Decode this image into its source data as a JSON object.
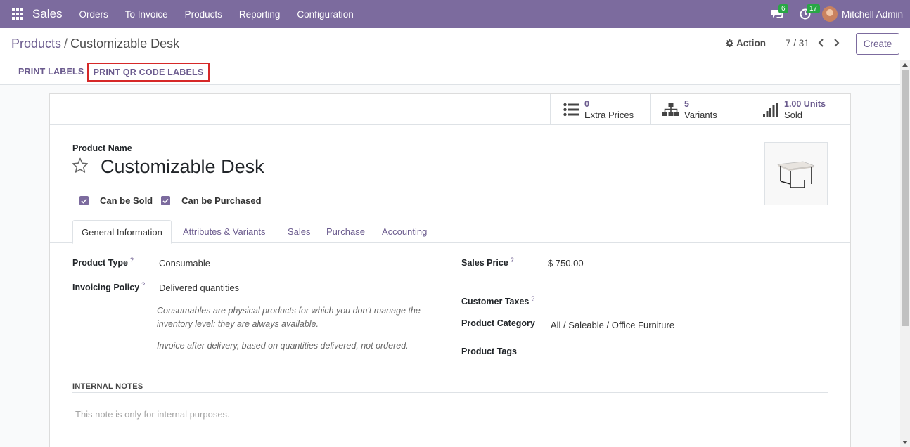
{
  "navbar": {
    "app_name": "Sales",
    "menu": [
      "Orders",
      "To Invoice",
      "Products",
      "Reporting",
      "Configuration"
    ],
    "messages_count": "6",
    "activities_count": "17",
    "user_name": "Mitchell Admin"
  },
  "control_panel": {
    "breadcrumb_parent": "Products",
    "breadcrumb_separator": "/",
    "breadcrumb_current": "Customizable Desk",
    "action_label": "Action",
    "pager": "7 / 31",
    "create_label": "Create"
  },
  "button_bar": {
    "print_labels": "PRINT LABELS",
    "print_qr_labels": "PRINT QR CODE LABELS"
  },
  "smart_buttons": [
    {
      "value": "0",
      "label": "Extra Prices",
      "icon": "list-icon"
    },
    {
      "value": "5",
      "label": "Variants",
      "icon": "sitemap-icon"
    },
    {
      "value": "1.00 Units",
      "label": "Sold",
      "icon": "signal-icon"
    }
  ],
  "product": {
    "name_label": "Product Name",
    "name": "Customizable Desk",
    "can_be_sold": "Can be Sold",
    "can_be_purchased": "Can be Purchased"
  },
  "tabs": [
    "General Information",
    "Attributes & Variants",
    "Sales",
    "Purchase",
    "Accounting"
  ],
  "general": {
    "product_type_label": "Product Type",
    "product_type": "Consumable",
    "invoicing_policy_label": "Invoicing Policy",
    "invoicing_policy": "Delivered quantities",
    "help_consumable_1": "Consumables are physical products for which you don't manage the",
    "help_consumable_2": "inventory level: they are always available.",
    "help_invoice": "Invoice after delivery, based on quantities delivered, not ordered.",
    "sales_price_label": "Sales Price",
    "sales_price": "$ 750.00",
    "customer_taxes_label": "Customer Taxes",
    "product_category_label": "Product Category",
    "product_category": "All / Saleable / Office Furniture",
    "product_tags_label": "Product Tags",
    "help_marker": "?"
  },
  "notes": {
    "title": "INTERNAL NOTES",
    "placeholder": "This note is only for internal purposes."
  },
  "colors": {
    "brand": "#7c6b9e",
    "link": "#6b5b8e",
    "highlight_border": "#d62828"
  }
}
